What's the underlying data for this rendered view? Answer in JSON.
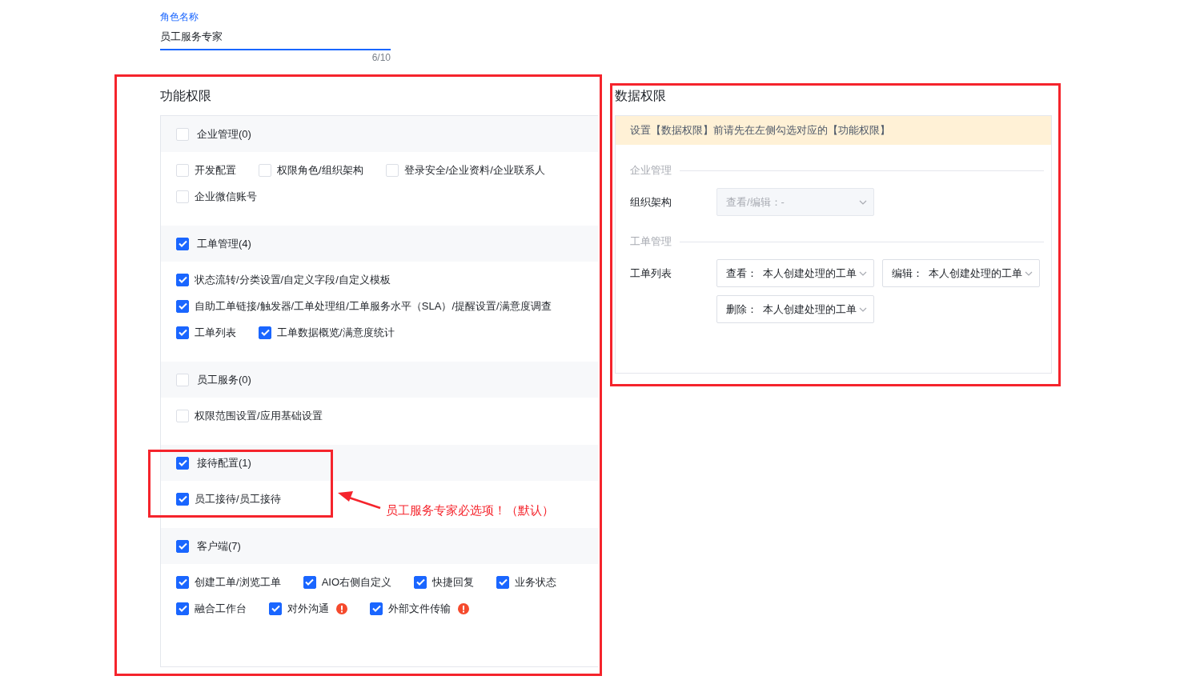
{
  "role_name": {
    "label": "角色名称",
    "value": "员工服务专家",
    "counter": "6/10"
  },
  "function_permissions": {
    "title": "功能权限",
    "groups": [
      {
        "label": "企业管理(0)",
        "checked": false,
        "item_rows": [
          [
            {
              "label": "开发配置",
              "checked": false,
              "warning": false
            },
            {
              "label": "权限角色/组织架构",
              "checked": false,
              "warning": false
            },
            {
              "label": "登录安全/企业资料/企业联系人",
              "checked": false,
              "warning": false
            }
          ],
          [
            {
              "label": "企业微信账号",
              "checked": false,
              "warning": false
            }
          ]
        ]
      },
      {
        "label": "工单管理(4)",
        "checked": true,
        "item_rows": [
          [
            {
              "label": "状态流转/分类设置/自定义字段/自定义模板",
              "checked": true,
              "warning": false
            }
          ],
          [
            {
              "label": "自助工单链接/触发器/工单处理组/工单服务水平（SLA）/提醒设置/满意度调查",
              "checked": true,
              "warning": false
            }
          ],
          [
            {
              "label": "工单列表",
              "checked": true,
              "warning": false
            },
            {
              "label": "工单数据概览/满意度统计",
              "checked": true,
              "warning": false
            }
          ]
        ]
      },
      {
        "label": "员工服务(0)",
        "checked": false,
        "item_rows": [
          [
            {
              "label": "权限范围设置/应用基础设置",
              "checked": false,
              "warning": false
            }
          ]
        ]
      },
      {
        "label": "接待配置(1)",
        "checked": true,
        "item_rows": [
          [
            {
              "label": "员工接待/员工接待",
              "checked": true,
              "warning": false
            }
          ]
        ]
      },
      {
        "label": "客户端(7)",
        "checked": true,
        "item_rows": [
          [
            {
              "label": "创建工单/浏览工单",
              "checked": true,
              "warning": false
            },
            {
              "label": "AIO右侧自定义",
              "checked": true,
              "warning": false
            },
            {
              "label": "快捷回复",
              "checked": true,
              "warning": false
            },
            {
              "label": "业务状态",
              "checked": true,
              "warning": false
            }
          ],
          [
            {
              "label": "融合工作台",
              "checked": true,
              "warning": false
            },
            {
              "label": "对外沟通",
              "checked": true,
              "warning": true
            },
            {
              "label": "外部文件传输",
              "checked": true,
              "warning": true
            }
          ]
        ]
      }
    ]
  },
  "data_permissions": {
    "title": "数据权限",
    "notice": "设置【数据权限】前请先在左侧勾选对应的【功能权限】",
    "sections": [
      {
        "title": "企业管理",
        "rows": [
          {
            "label": "组织架构",
            "selects": [
              {
                "text": "查看/编辑：-",
                "disabled": true
              }
            ]
          }
        ]
      },
      {
        "title": "工单管理",
        "rows": [
          {
            "label": "工单列表",
            "selects": [
              {
                "text": "查看：  本人创建处理的工单",
                "disabled": false
              },
              {
                "text": "编辑：  本人创建处理的工单",
                "disabled": false
              },
              {
                "text": "删除：  本人创建处理的工单",
                "disabled": false
              }
            ]
          }
        ]
      }
    ]
  },
  "annotation": {
    "text": "员工服务专家必选项！（默认）"
  }
}
